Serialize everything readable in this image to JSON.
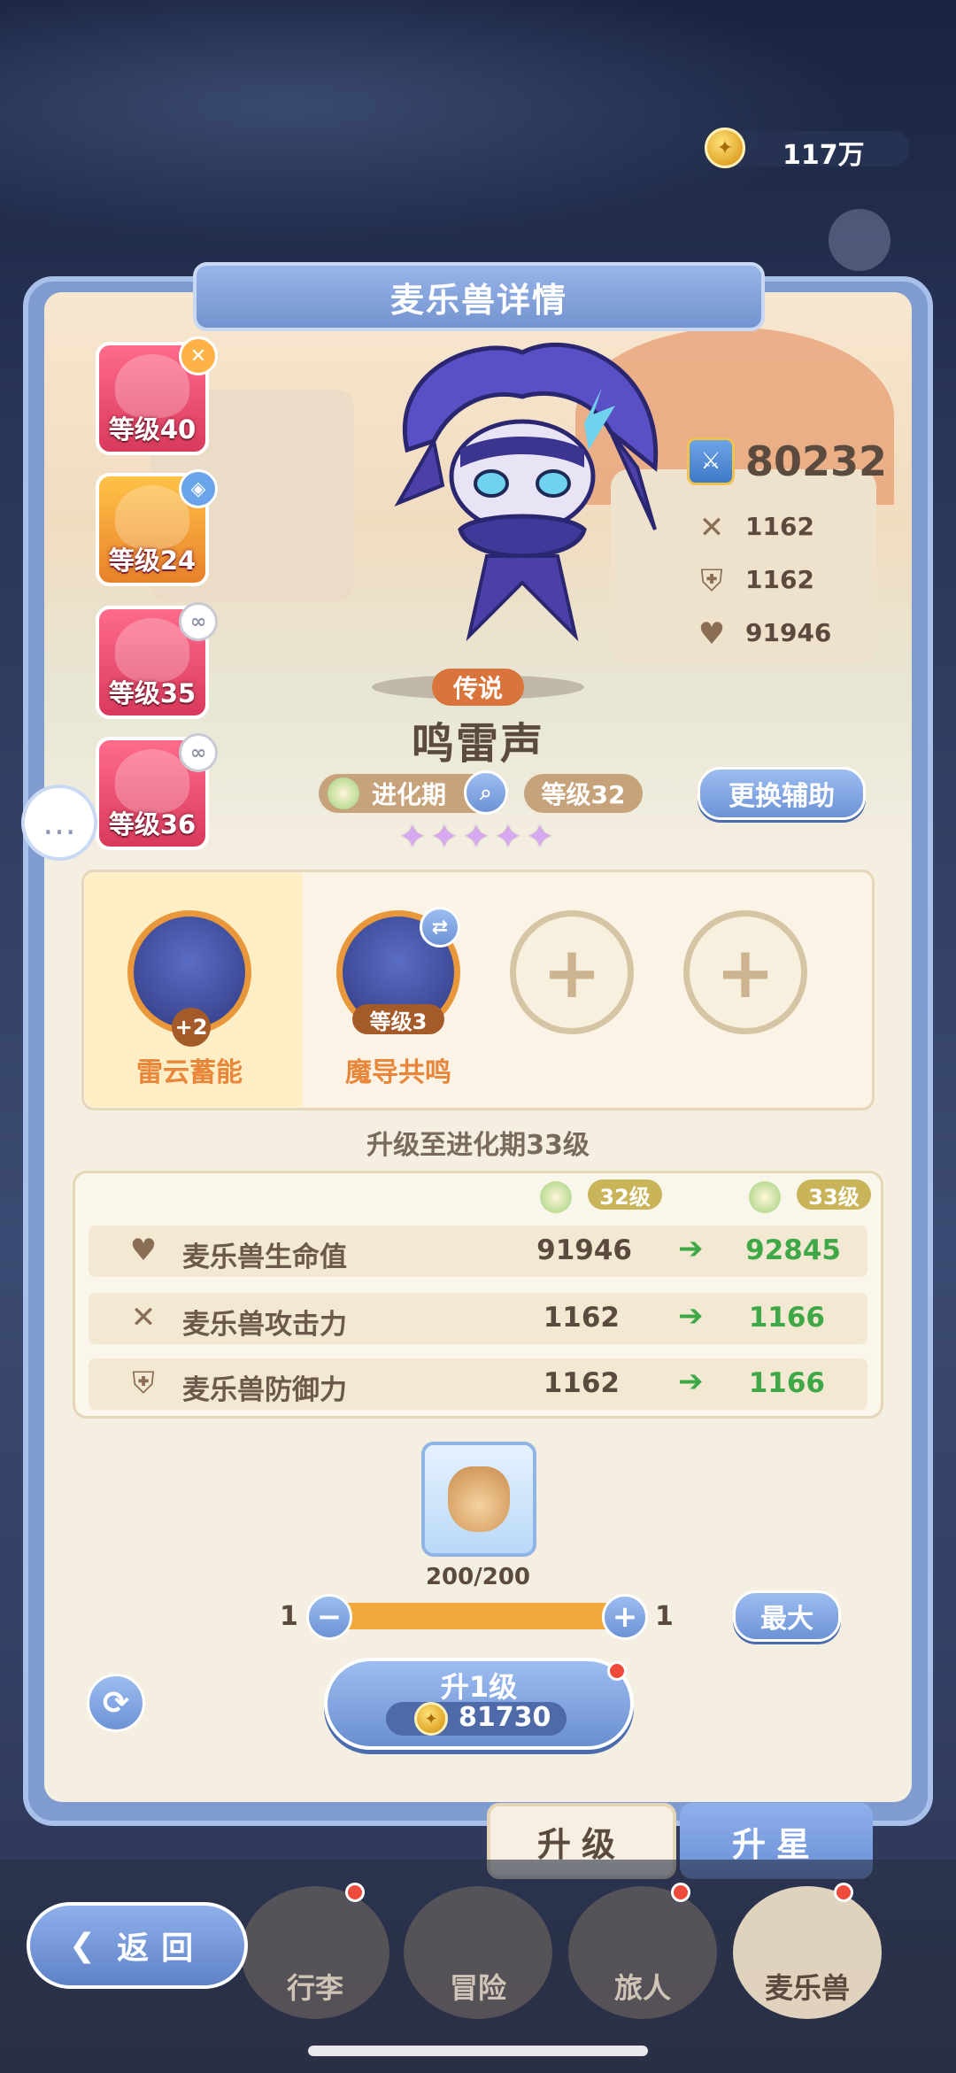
{
  "currency": {
    "amount": "117万"
  },
  "panel": {
    "title": "麦乐兽详情"
  },
  "team": [
    {
      "label": "等级40",
      "badge": "✕"
    },
    {
      "label": "等级24",
      "badge": "◈"
    },
    {
      "label": "等级35",
      "badge": "∞"
    },
    {
      "label": "等级36",
      "badge": "∞"
    }
  ],
  "stats": {
    "power": "80232",
    "attack": "1162",
    "defense": "1162",
    "hp": "91946"
  },
  "beast": {
    "rarity": "传说",
    "name": "鸣雷声",
    "stage": "进化期",
    "level": "等级32",
    "swap_label": "更换辅助",
    "stars": 5
  },
  "skills": [
    {
      "name": "雷云蓄能",
      "badge": "+2"
    },
    {
      "name": "魔导共鸣",
      "level": "等级3"
    }
  ],
  "upgrade": {
    "title": "升级至进化期33级",
    "from_level": "32级",
    "to_level": "33级",
    "rows": [
      {
        "label": "麦乐兽生命值",
        "from": "91946",
        "to": "92845"
      },
      {
        "label": "麦乐兽攻击力",
        "from": "1162",
        "to": "1166"
      },
      {
        "label": "麦乐兽防御力",
        "from": "1162",
        "to": "1166"
      }
    ],
    "item_count": "200/200",
    "qty_min": "1",
    "qty_current": "1",
    "max_label": "最大",
    "button_label": "升1级",
    "cost": "81730"
  },
  "tabs": {
    "upgrade": "升级",
    "star": "升星"
  },
  "nav": {
    "back": "返回",
    "items": [
      "行李",
      "冒险",
      "旅人",
      "麦乐兽"
    ]
  }
}
